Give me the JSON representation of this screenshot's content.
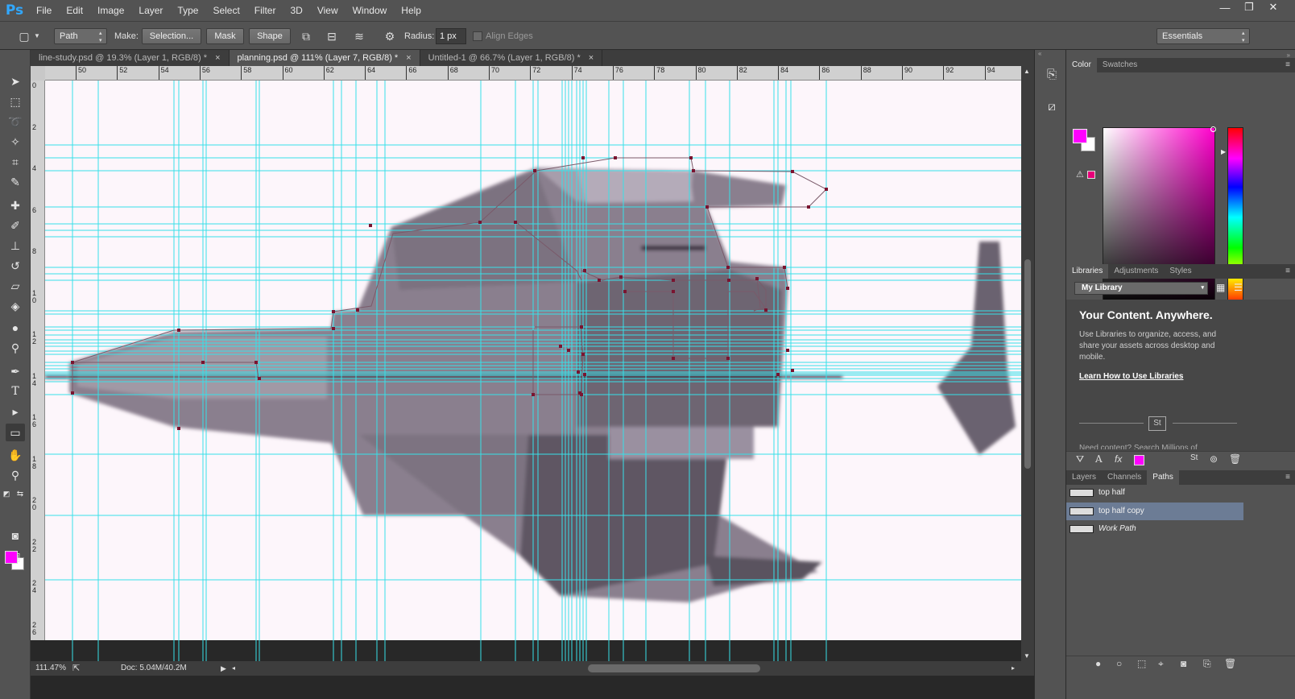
{
  "app": {
    "logo": "Ps"
  },
  "menu": [
    "File",
    "Edit",
    "Image",
    "Layer",
    "Type",
    "Select",
    "Filter",
    "3D",
    "View",
    "Window",
    "Help"
  ],
  "window_controls": {
    "minimize": "—",
    "restore": "❐",
    "close": "✕"
  },
  "options_bar": {
    "mode": "Path",
    "make_label": "Make:",
    "selection_btn": "Selection...",
    "mask_btn": "Mask",
    "shape_btn": "Shape",
    "radius_label": "Radius:",
    "radius_value": "1 px",
    "align_edges": "Align Edges",
    "workspace": "Essentials"
  },
  "tabs": [
    {
      "label": "line-study.psd @ 19.3% (Layer 1, RGB/8) *",
      "active": false
    },
    {
      "label": "planning.psd @ 111% (Layer 7, RGB/8) *",
      "active": true
    },
    {
      "label": "Untitled-1 @ 66.7% (Layer 1, RGB/8) *",
      "active": false
    }
  ],
  "rulers": {
    "top": [
      "50",
      "52",
      "54",
      "56",
      "58",
      "60",
      "62",
      "64",
      "66",
      "68",
      "70",
      "72",
      "74",
      "76",
      "78",
      "80",
      "82",
      "84",
      "86",
      "88",
      "90",
      "92",
      "94"
    ],
    "left": [
      "0",
      "2",
      "4",
      "6",
      "8",
      "10",
      "12",
      "14",
      "16",
      "18",
      "20",
      "22",
      "24",
      "26"
    ]
  },
  "status": {
    "zoom": "111.47%",
    "doc": "Doc: 5.04M/40.2M"
  },
  "color_panel": {
    "tabs": [
      "Color",
      "Swatches"
    ],
    "foreground": "#ff00ff",
    "background": "#ffffff"
  },
  "libraries_panel": {
    "tabs": [
      "Libraries",
      "Adjustments",
      "Styles"
    ],
    "library": "My Library",
    "headline": "Your Content. Anywhere.",
    "description": "Use Libraries to organize, access, and share your assets across desktop and mobile.",
    "link": "Learn How to Use Libraries",
    "badge": "St",
    "more": "Need content? Search Millions of"
  },
  "paths_panel": {
    "tabs": [
      "Layers",
      "Channels",
      "Paths"
    ],
    "items": [
      {
        "name": "top half",
        "selected": false
      },
      {
        "name": "top half copy",
        "selected": true
      },
      {
        "name": "Work Path",
        "selected": false
      }
    ]
  },
  "colors": {
    "guide": "#37e0e8",
    "anchor": "#7a1430",
    "accent": "#ff00ff"
  }
}
